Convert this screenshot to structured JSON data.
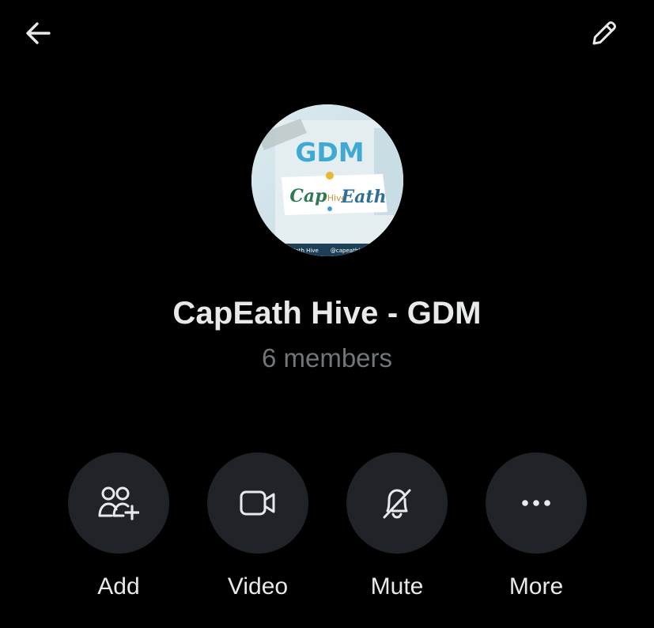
{
  "header": {
    "back_icon": "arrow-left-icon",
    "edit_icon": "pencil-icon"
  },
  "group": {
    "name": "CapEath Hive - GDM",
    "members": "6 members",
    "avatar": {
      "headline": "GDM",
      "logo_text": "Cap Hive Eath",
      "footer_text": "Cap Eath Hive   @capeathhive"
    }
  },
  "actions": [
    {
      "label": "Add",
      "icon": "add-people-icon"
    },
    {
      "label": "Video",
      "icon": "video-camera-icon"
    },
    {
      "label": "Mute",
      "icon": "bell-off-icon"
    },
    {
      "label": "More",
      "icon": "more-dots-icon"
    }
  ],
  "colors": {
    "background": "#000000",
    "primary_text": "#e7e9ea",
    "secondary_text": "#71767b",
    "button_bg": "#202327"
  }
}
